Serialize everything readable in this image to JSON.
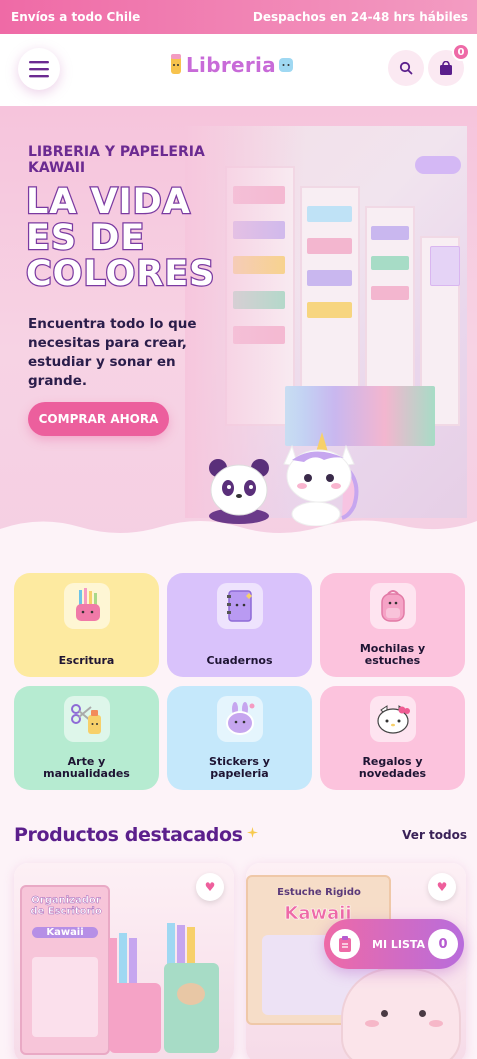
{
  "topbar": {
    "left": "Envíos a todo Chile",
    "right": "Despachos en 24-48 hrs hábiles"
  },
  "header": {
    "logo_text": "Libreria",
    "cart_count": "0"
  },
  "hero": {
    "subtitle": "LIBRERIA Y PAPELERIA KAWAII",
    "title_lines": [
      "LA VIDA",
      "ES DE",
      "COLORES"
    ],
    "text": "Encuentra todo lo que necesitas para crear, estudiar y sonar en grande.",
    "cta": "COMPRAR AHORA"
  },
  "categories": [
    {
      "label": "Escritura",
      "icon": "pencil-cup-icon",
      "color": "#fdeaa0"
    },
    {
      "label": "Cuadernos",
      "icon": "notebook-icon",
      "color": "#d9c2fb"
    },
    {
      "label": "Mochilas y estuches",
      "icon": "backpack-icon",
      "color": "#fcc3dd"
    },
    {
      "label": "Arte y manualidades",
      "icon": "scissors-glue-icon",
      "color": "#b6ebd1"
    },
    {
      "label": "Stickers y papeleria",
      "icon": "sticker-icon",
      "color": "#c5e8fb"
    },
    {
      "label": "Regalos y novedades",
      "icon": "hello-kitty-icon",
      "color": "#fcc3dd"
    }
  ],
  "featured": {
    "title": "Productos destacados",
    "link": "Ver todos"
  },
  "products": [
    {
      "box_title": "Organizador de Escritorio",
      "box_brand": "Kawaii"
    },
    {
      "box_title": "Estuche Rigido",
      "box_brand": "Kawaii"
    }
  ],
  "wishlist": {
    "label": "MI LISTA",
    "count": "0"
  }
}
